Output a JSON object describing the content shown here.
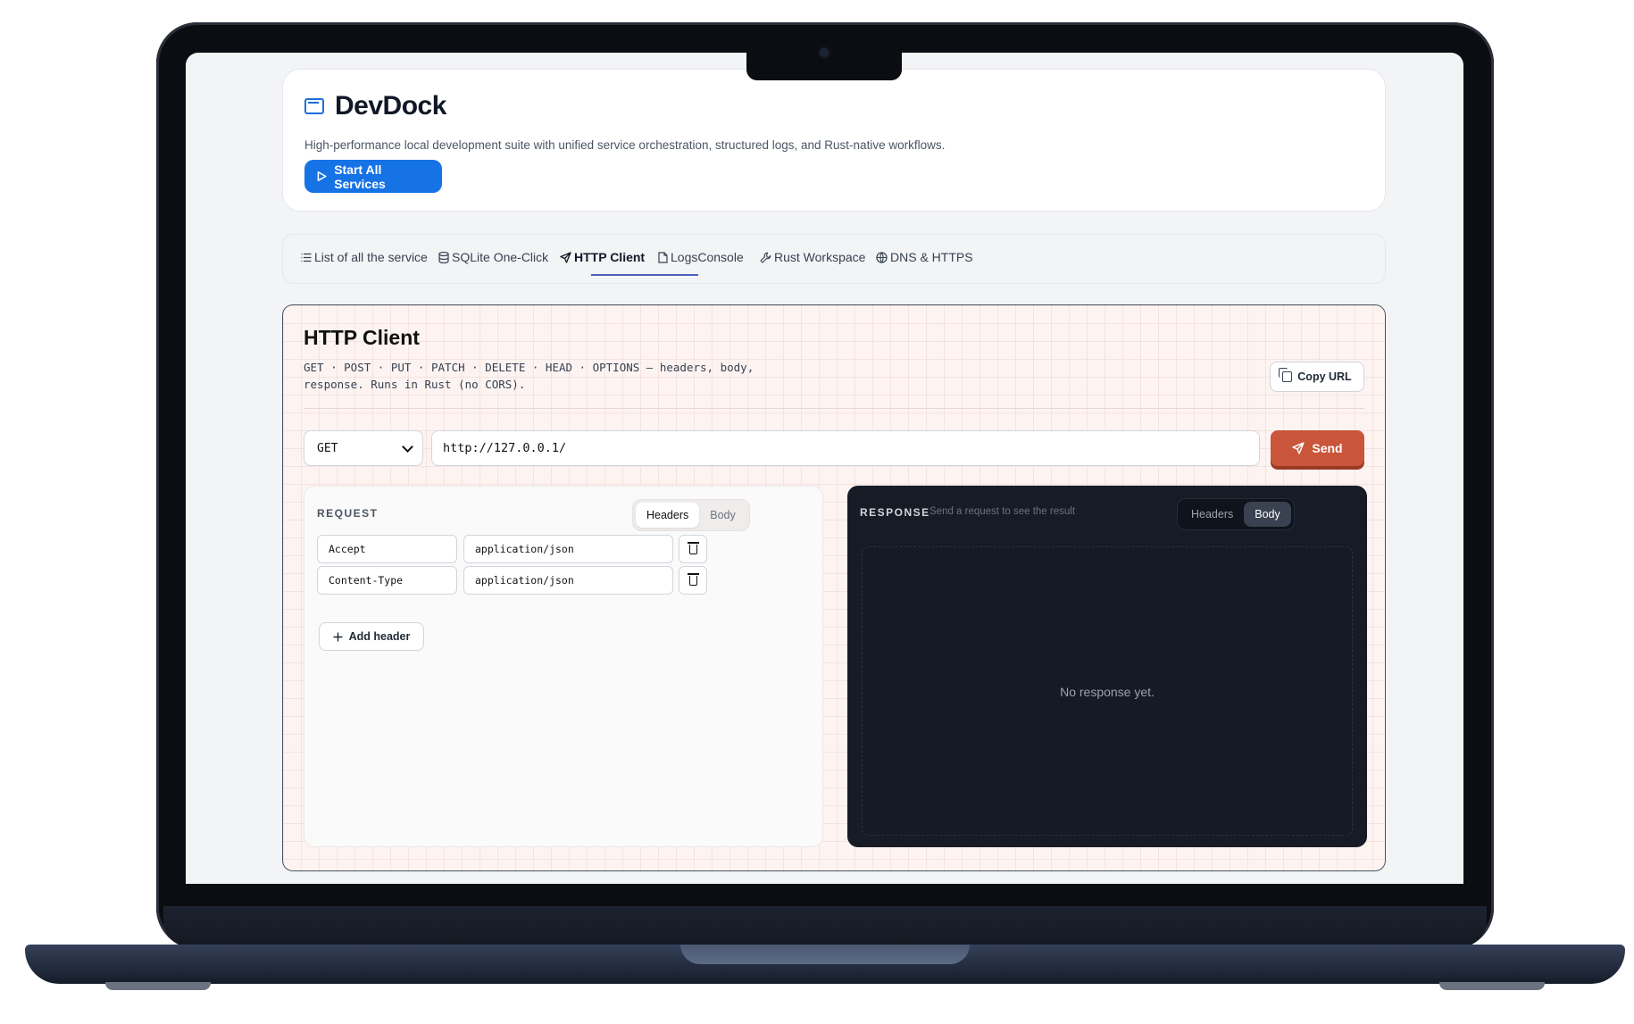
{
  "app": {
    "title": "DevDock",
    "subtitle": "High-performance local development suite with unified service orchestration, structured logs, and Rust-native workflows.",
    "start_button": "Start All Services"
  },
  "tabs": [
    {
      "label": "List of all the service",
      "icon": "list-icon"
    },
    {
      "label": "SQLite One-Click",
      "icon": "database-icon"
    },
    {
      "label": "HTTP Client",
      "icon": "send-icon",
      "active": true
    },
    {
      "label": "LogsConsole",
      "icon": "file-icon"
    },
    {
      "label": "Rust Workspace",
      "icon": "wrench-icon"
    },
    {
      "label": "DNS & HTTPS",
      "icon": "globe-icon"
    }
  ],
  "http_client": {
    "title": "HTTP Client",
    "description": "GET · POST · PUT · PATCH · DELETE · HEAD · OPTIONS — headers, body, response. Runs in Rust (no CORS).",
    "copy_url": "Copy URL",
    "method": "GET",
    "url": "http://127.0.0.1/",
    "send": "Send"
  },
  "request": {
    "label": "REQUEST",
    "tabs": {
      "headers": "Headers",
      "body": "Body"
    },
    "headers": [
      {
        "key": "Accept",
        "value": "application/json"
      },
      {
        "key": "Content-Type",
        "value": "application/json"
      }
    ],
    "add_header": "Add header"
  },
  "response": {
    "label": "RESPONSE",
    "hint": "Send a request to see the result",
    "tabs": {
      "headers": "Headers",
      "body": "Body"
    },
    "empty": "No response yet."
  },
  "colors": {
    "accent_blue": "#1673e6",
    "send_orange": "#c9553a",
    "response_bg": "#161b26"
  }
}
